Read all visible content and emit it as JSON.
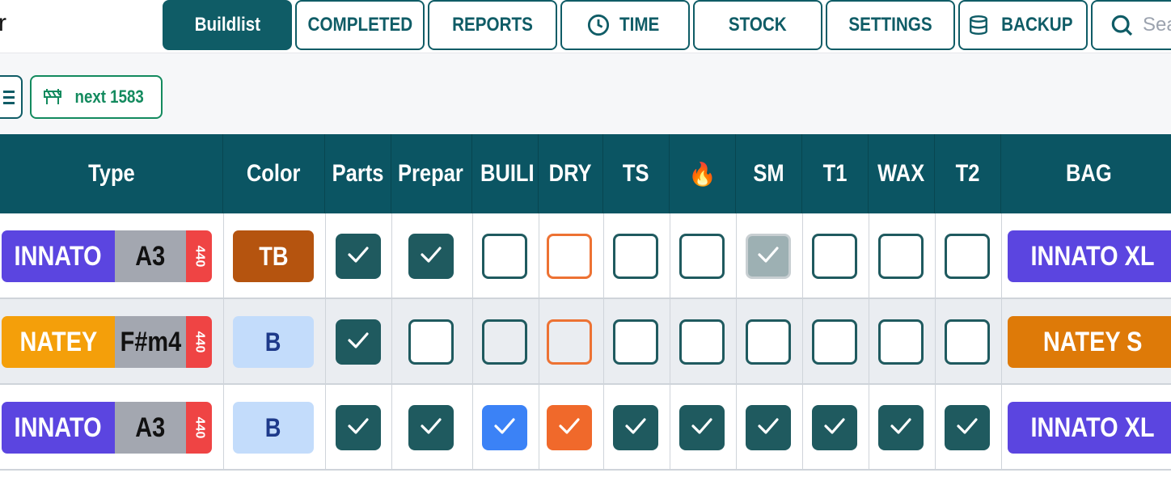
{
  "header": {
    "brand_fragment": "r",
    "nav": [
      {
        "label": "Buildlist",
        "active": true
      },
      {
        "label": "COMPLETED"
      },
      {
        "label": "REPORTS"
      },
      {
        "label": "TIME",
        "icon": "clock-icon"
      },
      {
        "label": "STOCK"
      },
      {
        "label": "SETTINGS"
      },
      {
        "label": "BACKUP",
        "icon": "database-icon"
      }
    ],
    "search_placeholder": "Sea"
  },
  "toolbar": {
    "menu_icon": "list-icon",
    "next_label": "next 1583",
    "next_icon": "roadblock-icon"
  },
  "table": {
    "columns": [
      "Type",
      "Color",
      "Parts",
      "Prepar",
      "BUILI",
      "DRY",
      "TS",
      "🔥",
      "SM",
      "T1",
      "WAX",
      "T2",
      "BAG"
    ],
    "rows": [
      {
        "type": "INNATO",
        "type_color": "#5b45e0",
        "note": "A3",
        "hz": "440",
        "color_code": "TB",
        "color_bg": "#b5540f",
        "color_fg": "#ffffff",
        "checks": [
          "checked",
          "checked",
          "empty",
          "empty-orange",
          "empty",
          "empty",
          "disabled",
          "empty",
          "empty",
          "empty"
        ],
        "bag": "INNATO XL",
        "bag_color": "#5b45e0"
      },
      {
        "type": "NATEY",
        "type_color": "#f49f0a",
        "note": "F#m4",
        "hz": "440",
        "color_code": "B",
        "color_bg": "#c3dcfb",
        "color_fg": "#1e3a8a",
        "checks": [
          "checked",
          "empty",
          "empty-gray",
          "empty-orange-gray",
          "empty",
          "empty",
          "empty",
          "empty",
          "empty",
          "empty"
        ],
        "bag": "NATEY S",
        "bag_color": "#de7a08"
      },
      {
        "type": "INNATO",
        "type_color": "#5b45e0",
        "note": "A3",
        "hz": "440",
        "color_code": "B",
        "color_bg": "#c3dcfb",
        "color_fg": "#1e3a8a",
        "checks": [
          "checked",
          "checked",
          "blue",
          "orange",
          "checked",
          "checked",
          "checked",
          "checked",
          "checked",
          "checked"
        ],
        "bag": "INNATO XL",
        "bag_color": "#5b45e0"
      }
    ]
  }
}
